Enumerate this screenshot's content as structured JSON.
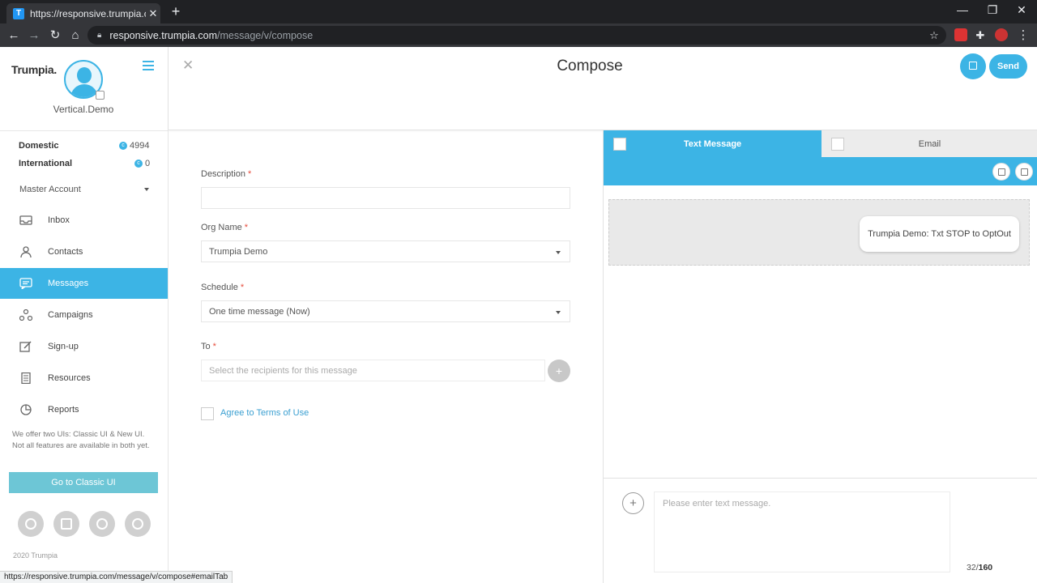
{
  "browser": {
    "tab_title": "https://responsive.trumpia.com/r",
    "tab_favicon": "T",
    "url_domain": "responsive.trumpia.com",
    "url_path": "/message/v/compose",
    "status_url": "https://responsive.trumpia.com/message/v/compose#emailTab"
  },
  "sidebar": {
    "logo": "Trumpia.",
    "username": "Vertical.Demo",
    "credits": [
      {
        "label": "Domestic",
        "value": "4994"
      },
      {
        "label": "International",
        "value": "0"
      }
    ],
    "account": "Master Account",
    "nav": [
      {
        "label": "Inbox",
        "icon": "inbox-icon"
      },
      {
        "label": "Contacts",
        "icon": "contacts-icon"
      },
      {
        "label": "Messages",
        "icon": "messages-icon",
        "active": true
      },
      {
        "label": "Campaigns",
        "icon": "campaigns-icon"
      },
      {
        "label": "Sign-up",
        "icon": "signup-icon"
      },
      {
        "label": "Resources",
        "icon": "resources-icon"
      },
      {
        "label": "Reports",
        "icon": "reports-icon"
      }
    ],
    "note": "We offer two UIs: Classic UI & New UI. Not all features are available in both yet.",
    "classic_button": "Go to Classic UI",
    "copyright": "2020 Trumpia"
  },
  "header": {
    "title": "Compose",
    "send_label": "Send"
  },
  "form": {
    "description_label": "Description",
    "description_value": "",
    "org_label": "Org Name",
    "org_value": "Trumpia Demo",
    "schedule_label": "Schedule",
    "schedule_value": "One time message (Now)",
    "to_label": "To",
    "to_placeholder": "Select the recipients for this message",
    "required_mark": "*",
    "add_recipient": "+",
    "agree_label": "Agree to Terms of Use"
  },
  "panel": {
    "tab_sms": "Text Message",
    "tab_email": "Email",
    "preview_text": "Trumpia Demo: Txt STOP to OptOut",
    "insert_btn": "+",
    "message_placeholder": "Please enter text message.",
    "count_used": "32",
    "count_sep": "/",
    "count_max": "160"
  },
  "colors": {
    "accent": "#3cb4e5",
    "classic_button": "#6dc6d6",
    "required": "#e74c3c"
  }
}
